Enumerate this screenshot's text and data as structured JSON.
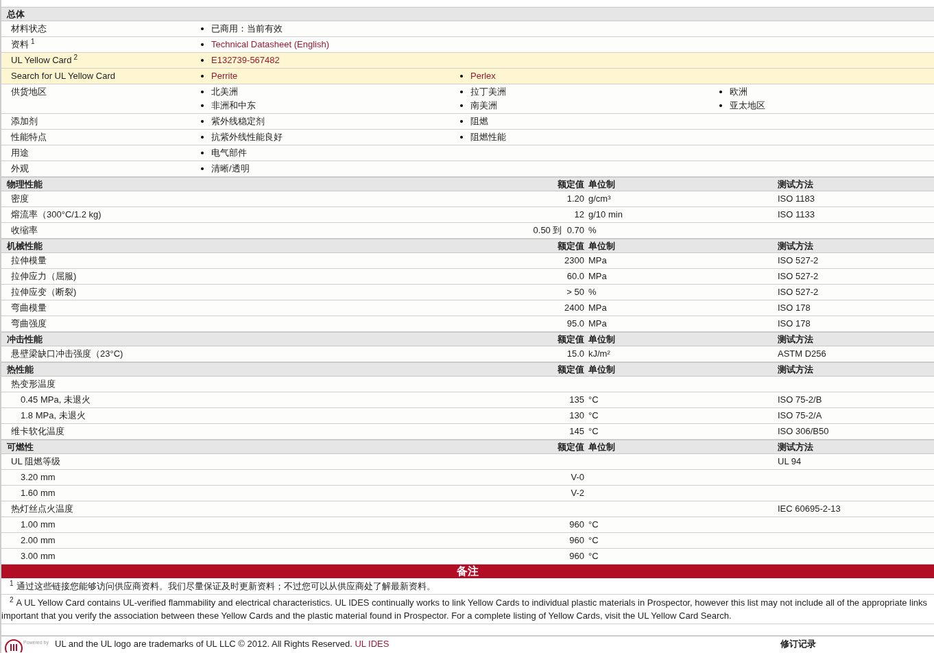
{
  "general": {
    "title": "总体",
    "rows": [
      {
        "label": "材料状态",
        "highlighted": false,
        "columns": [
          [
            {
              "text": "已商用：当前有效",
              "link": false
            }
          ]
        ]
      },
      {
        "label": "资料",
        "note": "1",
        "highlighted": false,
        "columns": [
          [
            {
              "text": "Technical Datasheet (English)",
              "link": true
            }
          ]
        ]
      },
      {
        "label": "UL Yellow Card",
        "note": "2",
        "highlighted": true,
        "columns": [
          [
            {
              "text": "E132739-567482",
              "link": true
            }
          ]
        ]
      },
      {
        "label": "Search for UL Yellow Card",
        "highlighted": true,
        "columns": [
          [
            {
              "text": "Perrite",
              "link": true
            }
          ],
          [
            {
              "text": "Perlex",
              "link": true
            }
          ]
        ]
      },
      {
        "label": "供货地区",
        "highlighted": false,
        "columns": [
          [
            {
              "text": "北美洲",
              "link": false
            },
            {
              "text": "非洲和中东",
              "link": false
            }
          ],
          [
            {
              "text": "拉丁美洲",
              "link": false
            },
            {
              "text": "南美洲",
              "link": false
            }
          ],
          [
            {
              "text": "欧洲",
              "link": false
            },
            {
              "text": "亚太地区",
              "link": false
            }
          ]
        ]
      },
      {
        "label": "添加剂",
        "highlighted": false,
        "columns": [
          [
            {
              "text": "紫外线稳定剂",
              "link": false
            }
          ],
          [
            {
              "text": "阻燃",
              "link": false
            }
          ]
        ]
      },
      {
        "label": "性能特点",
        "highlighted": false,
        "columns": [
          [
            {
              "text": "抗紫外线性能良好",
              "link": false
            }
          ],
          [
            {
              "text": "阻燃性能",
              "link": false
            }
          ]
        ]
      },
      {
        "label": "用途",
        "highlighted": false,
        "columns": [
          [
            {
              "text": "电气部件",
              "link": false
            }
          ]
        ]
      },
      {
        "label": "外观",
        "highlighted": false,
        "columns": [
          [
            {
              "text": "清晰/透明",
              "link": false
            }
          ]
        ]
      }
    ]
  },
  "sections": [
    {
      "title": "物理性能",
      "value_header": "额定值",
      "unit_header": "单位制",
      "method_header": "测试方法",
      "rows": [
        {
          "label": "密度",
          "value": "1.20",
          "unit": "g/cm³",
          "method": "ISO 1183"
        },
        {
          "label": "熔流率（300°C/1.2 kg)",
          "value": "12",
          "unit": "g/10 min",
          "method": "ISO 1133"
        },
        {
          "label": "收缩率",
          "value": "0.50 到  0.70",
          "unit": "%"
        }
      ]
    },
    {
      "title": "机械性能",
      "value_header": "额定值",
      "unit_header": "单位制",
      "method_header": "测试方法",
      "rows": [
        {
          "label": "拉伸模量",
          "value": "2300",
          "unit": "MPa",
          "method": "ISO 527-2"
        },
        {
          "label": "拉伸应力（屈服)",
          "value": "60.0",
          "unit": "MPa",
          "method": "ISO 527-2"
        },
        {
          "label": "拉伸应变（断裂)",
          "value": "> 50",
          "unit": "%",
          "method": "ISO 527-2"
        },
        {
          "label": "弯曲模量",
          "value": "2400",
          "unit": "MPa",
          "method": "ISO 178"
        },
        {
          "label": "弯曲强度",
          "value": "95.0",
          "unit": "MPa",
          "method": "ISO 178"
        }
      ]
    },
    {
      "title": "冲击性能",
      "value_header": "额定值",
      "unit_header": "单位制",
      "method_header": "测试方法",
      "rows": [
        {
          "label": "悬壁梁缺口冲击强度（23°C)",
          "value": "15.0",
          "unit": "kJ/m²",
          "method": "ASTM D256"
        }
      ]
    },
    {
      "title": "热性能",
      "value_header": "额定值",
      "unit_header": "单位制",
      "method_header": "测试方法",
      "rows": [
        {
          "label": "热变形温度",
          "children": [
            {
              "label": "0.45 MPa, 未退火",
              "value": "135",
              "unit": "°C",
              "method": "ISO 75-2/B"
            },
            {
              "label": "1.8 MPa, 未退火",
              "value": "130",
              "unit": "°C",
              "method": "ISO 75-2/A"
            }
          ]
        },
        {
          "label": "维卡软化温度",
          "value": "145",
          "unit": "°C",
          "method": "ISO 306/B50"
        }
      ]
    },
    {
      "title": "可燃性",
      "value_header": "额定值",
      "unit_header": "单位制",
      "method_header": "测试方法",
      "rows": [
        {
          "label": "UL 阻燃等级",
          "method": "UL 94",
          "children": [
            {
              "label": "3.20 mm",
              "value": "V-0"
            },
            {
              "label": "1.60 mm",
              "value": "V-2"
            }
          ]
        },
        {
          "label": "热灯丝点火温度",
          "method": "IEC 60695-2-13",
          "children": [
            {
              "label": "1.00 mm",
              "value": "960",
              "unit": "°C"
            },
            {
              "label": "2.00 mm",
              "value": "960",
              "unit": "°C"
            },
            {
              "label": "3.00 mm",
              "value": "960",
              "unit": "°C"
            }
          ]
        }
      ]
    }
  ],
  "notes": {
    "title": "备注",
    "items": [
      {
        "mark": "1",
        "lines": [
          "通过这些链接您能够访问供应商资料。我们尽量保证及时更新资料；不过您可以从供应商处了解最新资料。"
        ]
      },
      {
        "mark": "2",
        "lines": [
          "A UL Yellow Card contains UL-verified flammability and electrical characteristics. UL IDES continually works to link Yellow Cards to individual plastic materials in Prospector, however this list may not include all of the appropriate links",
          "important that you verify the association between these Yellow Cards and the plastic material found in Prospector. For a complete listing of Yellow Cards, visit the UL Yellow Card Search."
        ]
      }
    ]
  },
  "footer": {
    "powered_by": "Powered by",
    "text": "UL and the UL logo are trademarks of UL LLC © 2012. All Rights Reserved.",
    "link": "UL IDES",
    "revision_title": "修订记录"
  }
}
